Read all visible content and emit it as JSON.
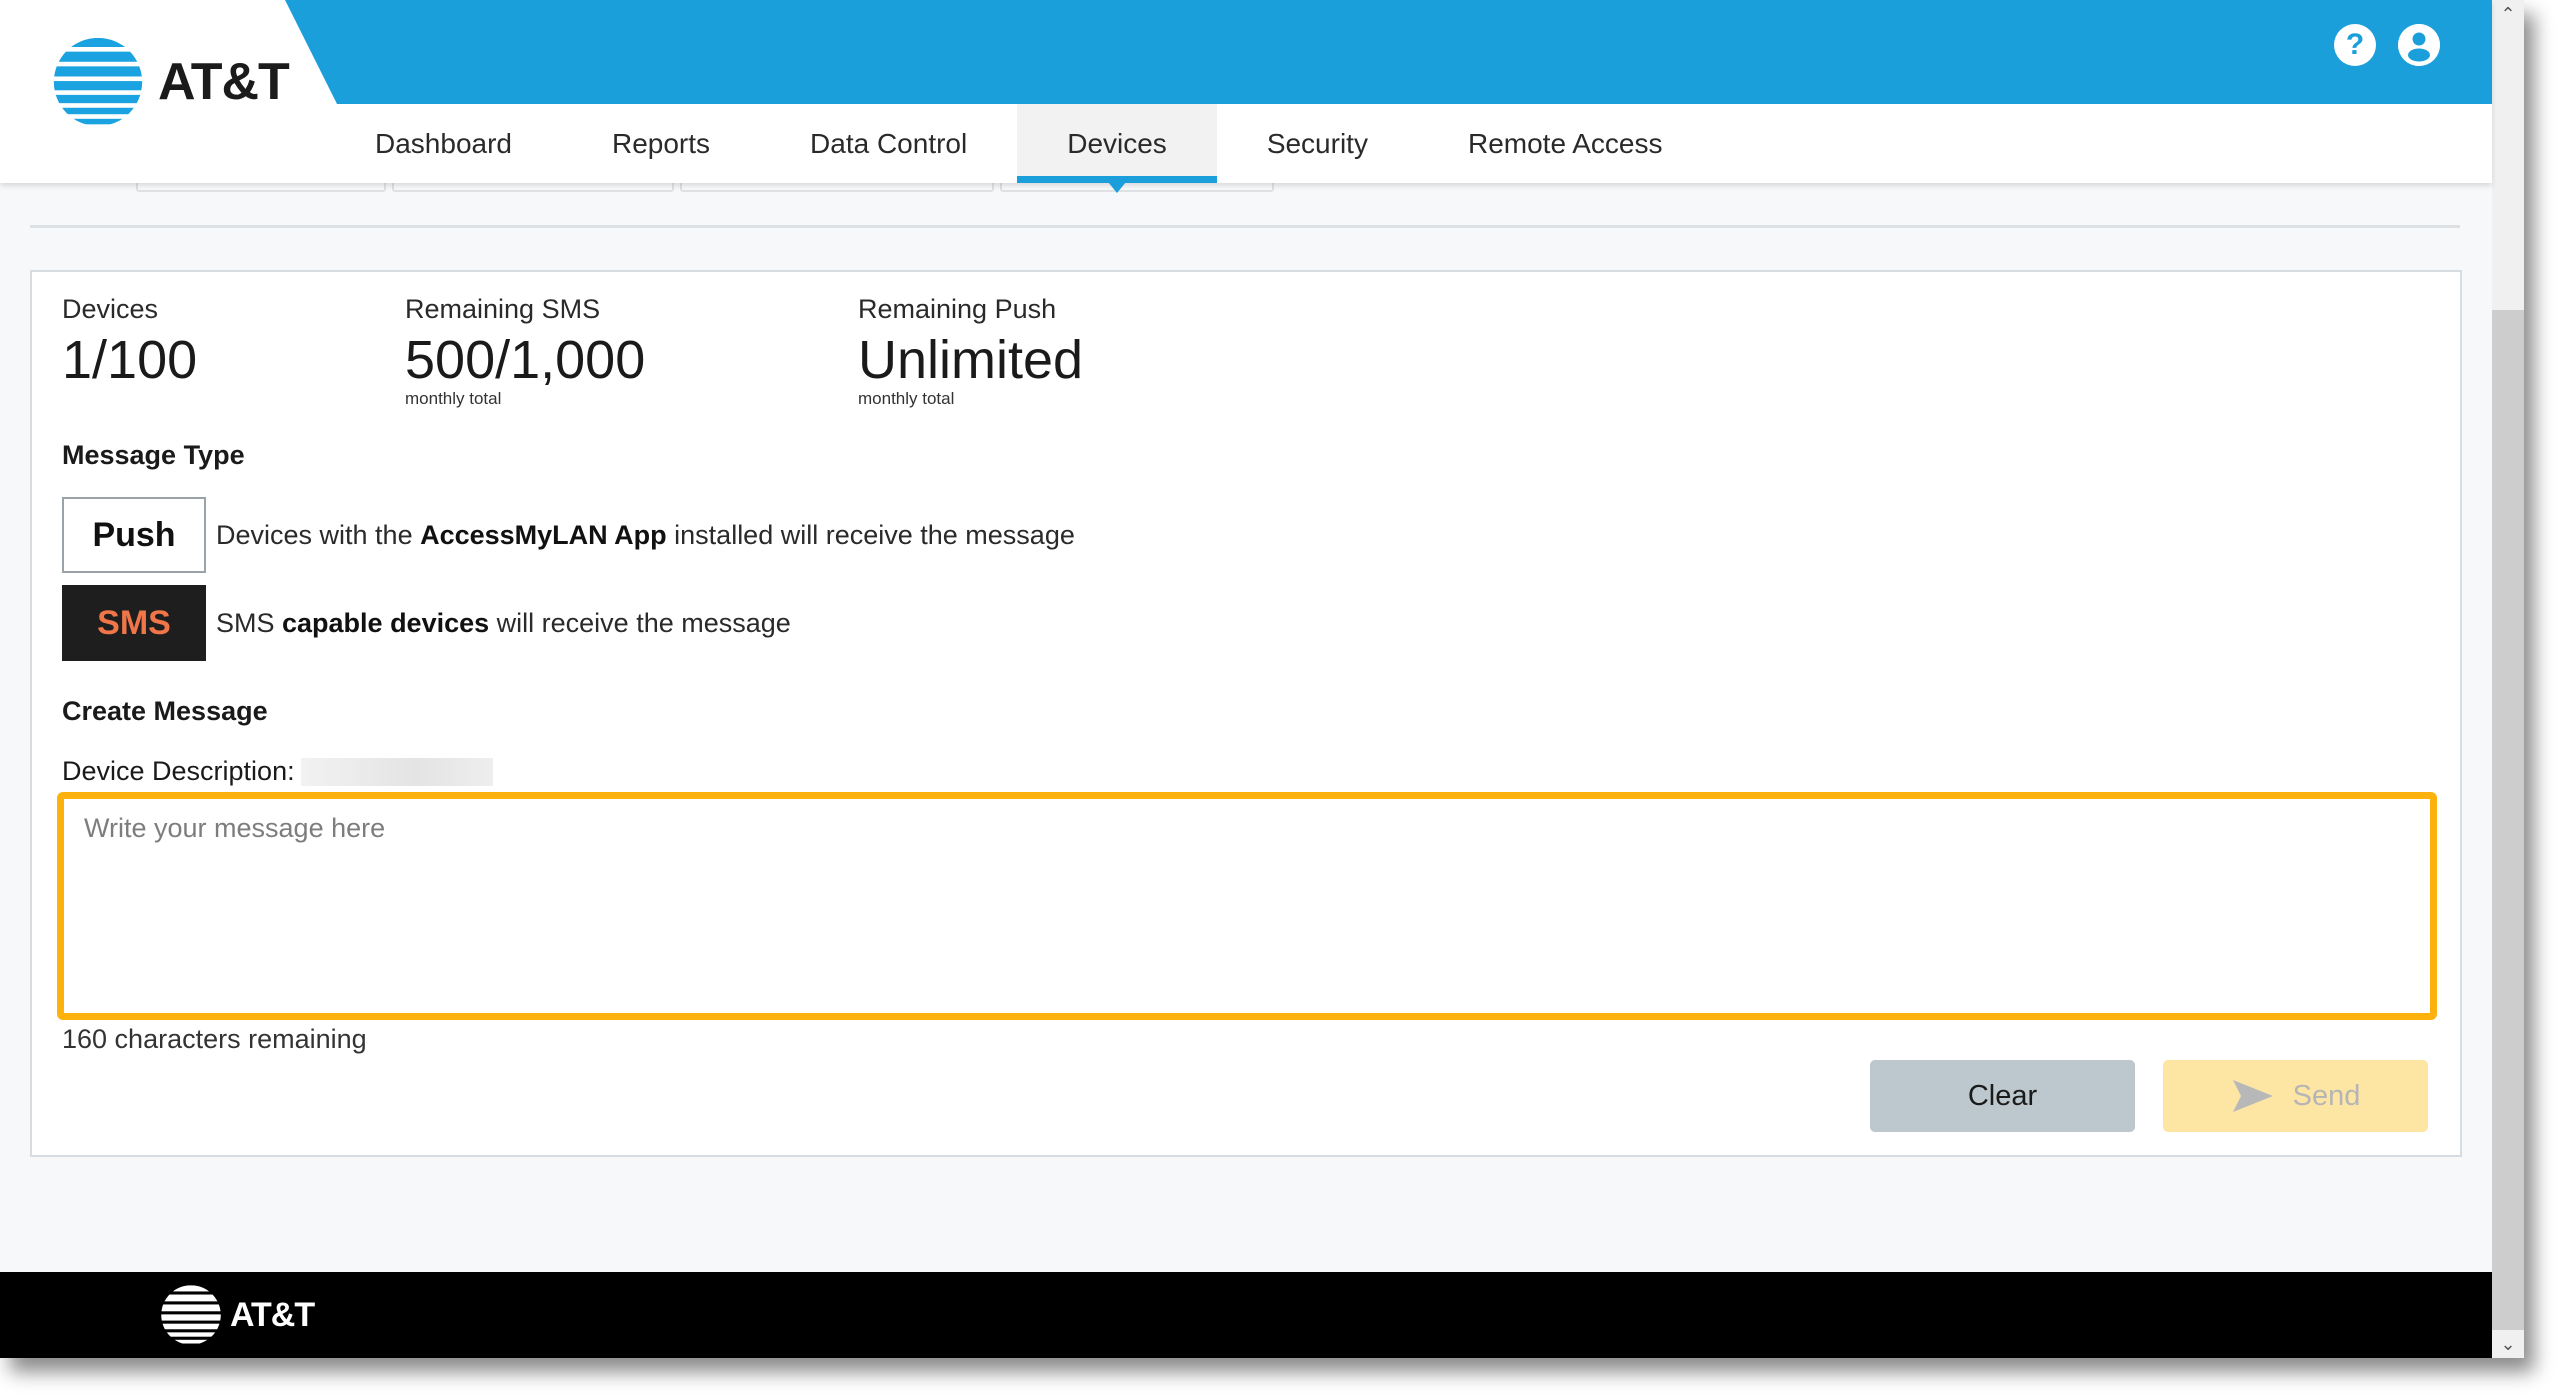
{
  "brand": {
    "name": "AT&T",
    "accent": "#1a9fdb",
    "highlight": "#fdb10d"
  },
  "header": {
    "icons": [
      {
        "name": "help-icon",
        "glyph": "?"
      },
      {
        "name": "user-account-icon",
        "glyph": "user"
      }
    ]
  },
  "nav": {
    "tabs": [
      {
        "label": "Dashboard",
        "active": false
      },
      {
        "label": "Reports",
        "active": false
      },
      {
        "label": "Data Control",
        "active": false
      },
      {
        "label": "Devices",
        "active": true
      },
      {
        "label": "Security",
        "active": false
      },
      {
        "label": "Remote Access",
        "active": false
      }
    ]
  },
  "stats": {
    "devices": {
      "label": "Devices",
      "value": "1/100"
    },
    "sms": {
      "label": "Remaining SMS",
      "value": "500/1,000",
      "sub": "monthly total"
    },
    "push": {
      "label": "Remaining Push",
      "value": "Unlimited",
      "sub": "monthly total"
    }
  },
  "message_type": {
    "title": "Message Type",
    "push": {
      "label": "Push",
      "desc_pre": "Devices with the ",
      "desc_bold": "AccessMyLAN App",
      "desc_post": " installed will receive the message"
    },
    "sms": {
      "label": "SMS",
      "desc_pre": "SMS ",
      "desc_bold": "capable devices",
      "desc_post": " will receive the message"
    }
  },
  "create_message": {
    "title": "Create Message",
    "device_description_label": "Device Description:",
    "placeholder": "Write your message here",
    "value": "",
    "chars_remaining": "160 characters remaining",
    "clear_label": "Clear",
    "send_label": "Send"
  },
  "footer": {
    "brand": "AT&T"
  }
}
